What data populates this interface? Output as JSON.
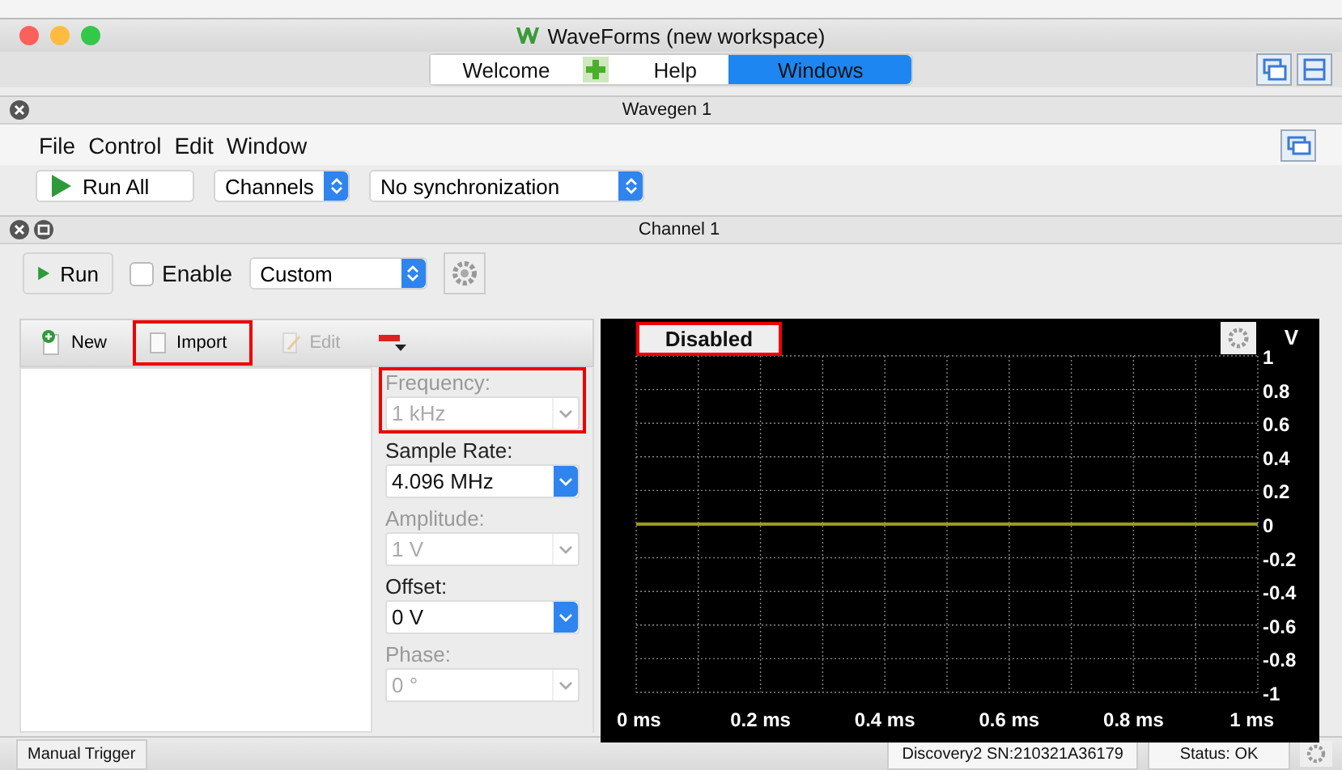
{
  "window": {
    "title": "WaveForms (new workspace)"
  },
  "tabs": [
    {
      "label": "Welcome",
      "selected": false,
      "has_add": true
    },
    {
      "label": "Help",
      "selected": false,
      "has_add": false
    },
    {
      "label": "Windows",
      "selected": true,
      "has_add": false
    }
  ],
  "instrument": {
    "title": "Wavegen 1",
    "menu": [
      "File",
      "Control",
      "Edit",
      "Window"
    ],
    "run_all": "Run All",
    "channels": "Channels",
    "sync": "No synchronization"
  },
  "channel": {
    "title": "Channel 1",
    "run": "Run",
    "enable": {
      "label": "Enable",
      "checked": false
    },
    "mode": "Custom"
  },
  "custom_toolbar": [
    {
      "label": "New",
      "disabled": false,
      "highlighted": false
    },
    {
      "label": "Import",
      "disabled": false,
      "highlighted": true
    },
    {
      "label": "Edit",
      "disabled": true,
      "highlighted": false
    }
  ],
  "params": [
    {
      "label": "Frequency:",
      "value": "1 kHz",
      "disabled": true,
      "highlighted": true
    },
    {
      "label": "Sample Rate:",
      "value": "4.096 MHz",
      "disabled": false,
      "highlighted": false
    },
    {
      "label": "Amplitude:",
      "value": "1 V",
      "disabled": true,
      "highlighted": false
    },
    {
      "label": "Offset:",
      "value": "0 V",
      "disabled": false,
      "highlighted": false
    },
    {
      "label": "Phase:",
      "value": "0 °",
      "disabled": true,
      "highlighted": false
    }
  ],
  "scope": {
    "status": "Disabled",
    "status_highlighted": true,
    "unit": "V",
    "chart_data": {
      "type": "line",
      "x": [
        0,
        1
      ],
      "xlim": [
        0,
        1
      ],
      "ylim": [
        -1,
        1
      ],
      "xticks": [
        {
          "value": 0,
          "label": "0 ms"
        },
        {
          "value": 0.2,
          "label": "0.2 ms"
        },
        {
          "value": 0.4,
          "label": "0.4 ms"
        },
        {
          "value": 0.6,
          "label": "0.6 ms"
        },
        {
          "value": 0.8,
          "label": "0.8 ms"
        },
        {
          "value": 1,
          "label": "1 ms"
        }
      ],
      "yticks": [
        {
          "value": 1,
          "label": "1"
        },
        {
          "value": 0.8,
          "label": "0.8"
        },
        {
          "value": 0.6,
          "label": "0.6"
        },
        {
          "value": 0.4,
          "label": "0.4"
        },
        {
          "value": 0.2,
          "label": "0.2"
        },
        {
          "value": 0,
          "label": "0"
        },
        {
          "value": -0.2,
          "label": "-0.2"
        },
        {
          "value": -0.4,
          "label": "-0.4"
        },
        {
          "value": -0.6,
          "label": "-0.6"
        },
        {
          "value": -0.8,
          "label": "-0.8"
        },
        {
          "value": -1,
          "label": "-1"
        }
      ],
      "grid": true,
      "series": [
        {
          "color": "#9a9a1a",
          "values": [
            0,
            0
          ]
        }
      ]
    }
  },
  "status_bar": {
    "trigger": "Manual Trigger",
    "device": "Discovery2 SN:210321A36179",
    "status": "Status: OK"
  }
}
